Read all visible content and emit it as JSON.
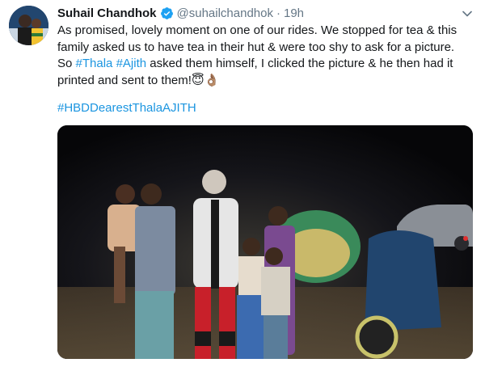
{
  "tweet": {
    "author_name": "Suhail Chandhok",
    "handle": "@suhailchandhok",
    "separator": "·",
    "time": "19h",
    "text_line1": "As promised, lovely moment on one of our rides. We stopped for tea & this",
    "text_line2": "family asked us to have tea in their hut & were too shy to ask for a picture.",
    "text_line3_pre": "So ",
    "text_line3_tag1": "#Thala",
    "text_line3_space": " ",
    "text_line3_tag2": "#Ajith",
    "text_line3_post": " asked them himself, I clicked the picture & he then had it",
    "text_line4": "printed and sent to them!😇👌🏽",
    "hashtag": "#HBDDearestThalaAJITH"
  },
  "icons": {
    "verified": "verified-badge-icon",
    "caret": "chevron-down-icon"
  },
  "colors": {
    "link": "#1b95e0",
    "verified": "#1da1f2",
    "muted": "#657786"
  }
}
